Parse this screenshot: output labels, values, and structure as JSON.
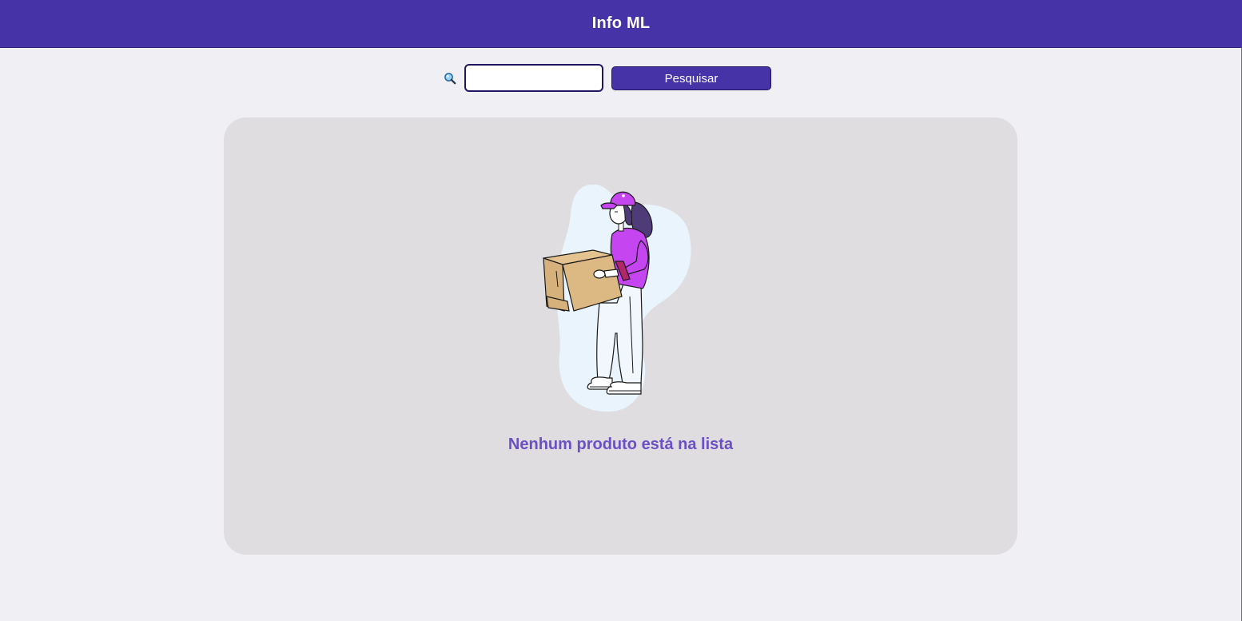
{
  "header": {
    "title": "Info ML"
  },
  "search": {
    "icon": "search-icon",
    "value": "",
    "placeholder": "",
    "button_label": "Pesquisar"
  },
  "main": {
    "empty_message": "Nenhum produto está na lista",
    "illustration": "delivery-person-holding-box"
  },
  "colors": {
    "header_bg": "#4733a8",
    "page_bg": "#f0eff4",
    "panel_bg": "#dfdddf",
    "message_text": "#6a4fc6",
    "button_bg": "#4733a8"
  }
}
